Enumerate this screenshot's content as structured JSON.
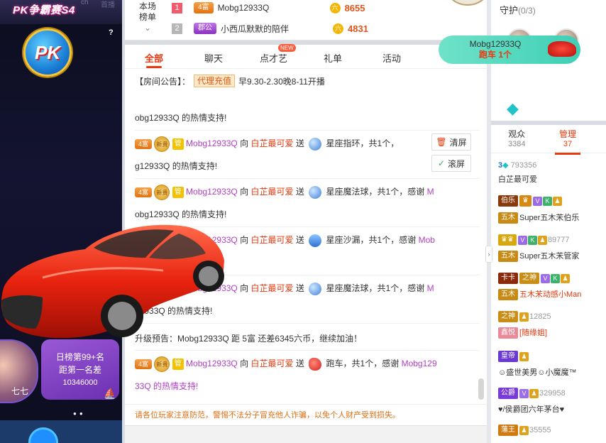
{
  "left": {
    "title": "PK争霸赛S4",
    "ghost_a": "ch",
    "ghost_b": "首播",
    "help": "?",
    "pk_label": "PK",
    "rank_line1": "日榜第99+名",
    "rank_line2": "距第一名差",
    "rank_gap": "10346000",
    "avatar_name": "七七"
  },
  "rank": {
    "label": "本场榜单",
    "rows": [
      {
        "num": "1",
        "tag": "4富",
        "name": "Mobg12933Q",
        "score": "8655"
      },
      {
        "num": "2",
        "tag": "郡公",
        "name": "小西瓜默默的陪伴",
        "score": "4831"
      }
    ]
  },
  "tabs": [
    "全部",
    "聊天",
    "点才艺",
    "礼单",
    "活动"
  ],
  "new_badge": "NEW",
  "notice": {
    "prefix": "【房间公告】：",
    "agent": "代理充值",
    "text": "早9.30-2.30晚8-11开播"
  },
  "buttons": {
    "clear": "清屏",
    "scroll": "滚屏"
  },
  "messages": {
    "m0_tail": "obg12933Q 的热情支持!",
    "m1_user": "Mobg12933Q",
    "m1_to": "向",
    "m1_host": "白芷最可爱",
    "m1_send": "送",
    "m1_gift": "星座指环，共1个，",
    "m1_tail": "g12933Q 的热情支持!",
    "m2_user": "Mobg12933Q",
    "m2_to": "向",
    "m2_host": "白芷最可爱",
    "m2_send": "送",
    "m2_gift": "星座魔法球，共1个，感谢",
    "m2_m": "M",
    "m2_tail": "obg12933Q 的热情支持!",
    "m3_user": "Mobg12933Q",
    "m3_to": "向",
    "m3_host": "白芷最可爱",
    "m3_send": "送",
    "m3_gift": "星座沙漏，共1个，感谢",
    "m3_m": "Mob",
    "m4_user": "Mobg12933Q",
    "m4_to": "向",
    "m4_host": "白芷最可爱",
    "m4_send": "送",
    "m4_gift": "星座魔法球，共1个，感谢",
    "m4_m": "M",
    "m4_tail": "12933Q 的热情支持!",
    "upgrade": "升级预告：Mobg12933Q 距 5富 还差6345六币，继续加油！",
    "m5_user": "Mobg12933Q",
    "m5_to": "向",
    "m5_host": "白芷最可爱",
    "m5_send": "送",
    "m5_gift": "跑车，共1个，感谢",
    "m5_m": "Mobg129",
    "m5_tail": "33Q 的热情支持!",
    "badge_fu": "4富",
    "badge_new": "新贵",
    "badge_guan": "管"
  },
  "warning": "请各位玩家注意防范，警惕不法分子冒充他人诈骗，以免个人财产受到损失。",
  "gift_bubble": {
    "user": "Mobg12933Q",
    "gift": "跑车",
    "count": "1个"
  },
  "guard": {
    "label": "守护",
    "count": "(0/3)"
  },
  "audience": {
    "tab_viewers": "观众",
    "viewers": "3384",
    "tab_admin": "管理",
    "admins": "37",
    "host_num": "793356",
    "host_name": "白芷最可爱",
    "e1_tag": "伯乐",
    "e1_tag2": "五木",
    "e1_name": "Super五木㭉伯乐",
    "e2_tag": "五木",
    "e2_num": "89777",
    "e2_name": "Super五木㭉管家",
    "e3_tag": "卡卡",
    "e3_tag2": "之神",
    "e3_tag3": "五木",
    "e3_name": "五木㭉动感小Man",
    "e4_tag": "之神",
    "e4_num": "12825",
    "e4_tag2": "鑫悦",
    "e4_name": "[随缘姐]",
    "e5_tag": "皇帝",
    "e5_name": "☺盛世美男☺小魔魔™",
    "e6_tag": "公爵",
    "e6_num": "329958",
    "e6_name": "♥/侯爵团六年茅台♥",
    "e7_tag": "藩王",
    "e7_num": "35555",
    "v": "V",
    "k": "K"
  }
}
